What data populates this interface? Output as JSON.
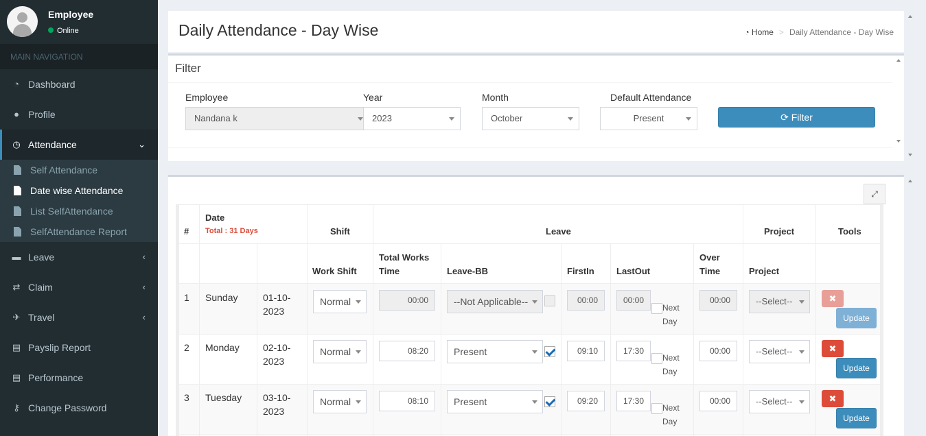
{
  "user": {
    "name": "Employee",
    "status": "Online"
  },
  "nav": {
    "header": "MAIN NAVIGATION",
    "items": [
      {
        "label": "Dashboard",
        "icon": "dashboard-icon"
      },
      {
        "label": "Profile",
        "icon": "user-icon"
      },
      {
        "label": "Attendance",
        "icon": "clock-icon"
      },
      {
        "label": "Leave",
        "icon": "calendar-icon"
      },
      {
        "label": "Claim",
        "icon": "exchange-icon"
      },
      {
        "label": "Travel",
        "icon": "plane-icon"
      },
      {
        "label": "Payslip Report",
        "icon": "file-icon"
      },
      {
        "label": "Performance",
        "icon": "file-icon"
      },
      {
        "label": "Change Password",
        "icon": "key-icon"
      }
    ],
    "attendance_sub": [
      "Self Attendance",
      "Date wise Attendance",
      "List SelfAttendance",
      "SelfAttendance Report"
    ]
  },
  "page": {
    "title": "Daily Attendance - Day Wise"
  },
  "breadcrumb": {
    "home": "Home",
    "current": "Daily Attendance - Day Wise"
  },
  "filter": {
    "title": "Filter",
    "employee_label": "Employee",
    "employee_value": "Nandana k",
    "year_label": "Year",
    "year_value": "2023",
    "month_label": "Month",
    "month_value": "October",
    "default_label": "Default Attendance",
    "default_value": "Present",
    "button": "Filter"
  },
  "table": {
    "headers": {
      "num": "#",
      "date": "Date",
      "total": "Total : 31 Days",
      "shift": "Shift",
      "leave": "Leave",
      "project": "Project",
      "tools": "Tools",
      "work_shift": "Work Shift",
      "total_works": "Total Works",
      "time": "Time",
      "leave_bb": "Leave-BB",
      "first_in": "FirstIn",
      "last_out": "LastOut",
      "over": "Over",
      "over_time": "Time",
      "project_sub": "Project"
    },
    "next_day_1": "Next",
    "next_day_2": "Day",
    "update_label": "Update",
    "rows": [
      {
        "num": "1",
        "day": "Sunday",
        "date1": "01-10-",
        "date2": "2023",
        "shift": "Normal",
        "total": "00:00",
        "leave": "--Not Applicable--",
        "checked": false,
        "first_in": "00:00",
        "last_out": "00:00",
        "over_time": "00:00",
        "project": "--Select--"
      },
      {
        "num": "2",
        "day": "Monday",
        "date1": "02-10-",
        "date2": "2023",
        "shift": "Normal",
        "total": "08:20",
        "leave": "Present",
        "checked": true,
        "first_in": "09:10",
        "last_out": "17:30",
        "over_time": "00:00",
        "project": "--Select--"
      },
      {
        "num": "3",
        "day": "Tuesday",
        "date1": "03-10-",
        "date2": "2023",
        "shift": "Normal",
        "total": "08:10",
        "leave": "Present",
        "checked": true,
        "first_in": "09:20",
        "last_out": "17:30",
        "over_time": "00:00",
        "project": "--Select--"
      }
    ]
  }
}
